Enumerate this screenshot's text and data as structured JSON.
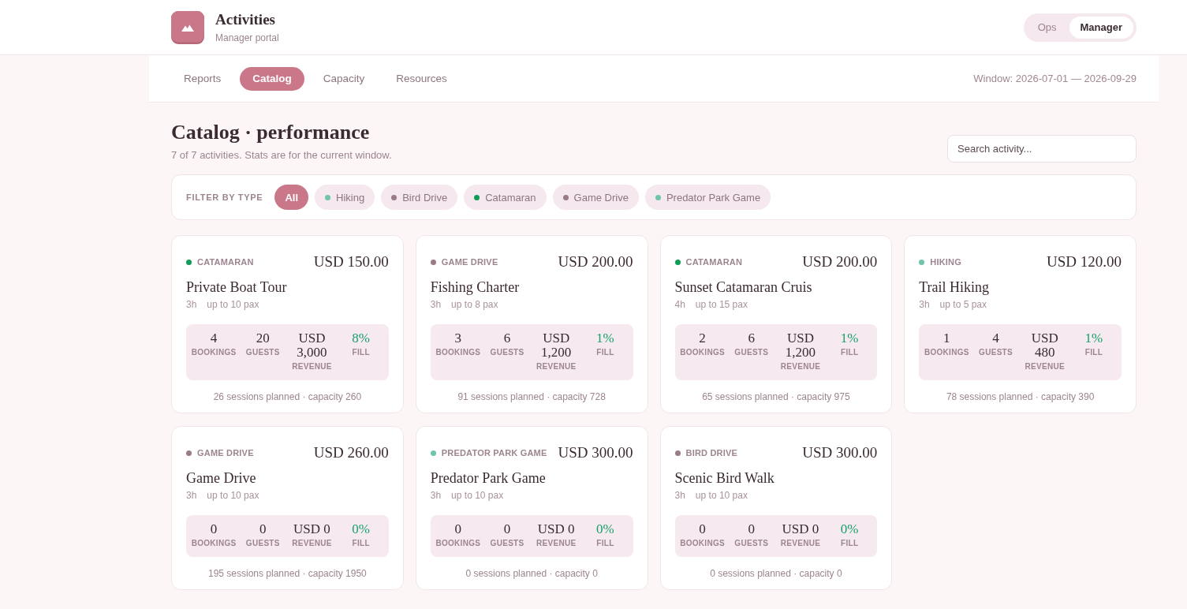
{
  "header": {
    "title": "Activities",
    "subtitle": "Manager portal",
    "role_toggle": [
      {
        "label": "Ops",
        "selected": false
      },
      {
        "label": "Manager",
        "selected": true
      }
    ]
  },
  "nav": {
    "tabs": [
      {
        "label": "Reports",
        "selected": false
      },
      {
        "label": "Catalog",
        "selected": true
      },
      {
        "label": "Capacity",
        "selected": false
      },
      {
        "label": "Resources",
        "selected": false
      }
    ],
    "window": "Window: 2026-07-01 — 2026-09-29"
  },
  "page": {
    "title": "Catalog · performance",
    "subtitle": "7 of 7 activities. Stats are for the current window.",
    "search": {
      "placeholder": "Search activity..."
    }
  },
  "filter": {
    "label": "FILTER BY TYPE",
    "chips": [
      {
        "label": "All",
        "selected": true
      },
      {
        "label": "Hiking",
        "selected": false,
        "color": "#6fc4ad"
      },
      {
        "label": "Bird Drive",
        "selected": false,
        "color": "#9a7b88"
      },
      {
        "label": "Catamaran",
        "selected": false,
        "color": "#0f9d58"
      },
      {
        "label": "Game Drive",
        "selected": false,
        "color": "#9a7b88"
      },
      {
        "label": "Predator Park Game",
        "selected": false,
        "color": "#6fc4ad"
      }
    ]
  },
  "activities": [
    {
      "type": "CATAMARAN",
      "color": "#0f9d58",
      "price": "USD 150.00",
      "name": "Private Boat Tour",
      "duration": "3h",
      "capacity": "up to 10 pax",
      "stats": [
        {
          "kind": "count",
          "value": "4",
          "label": "BOOKINGS"
        },
        {
          "kind": "count",
          "value": "20",
          "label": "GUESTS"
        },
        {
          "kind": "count",
          "value": "USD 3,000",
          "label": "REVENUE"
        },
        {
          "kind": "fill",
          "value": "8%",
          "label": "FILL"
        }
      ],
      "footer": "26 sessions planned · capacity 260"
    },
    {
      "type": "GAME DRIVE",
      "color": "#9a7b88",
      "price": "USD 200.00",
      "name": "Fishing Charter",
      "duration": "3h",
      "capacity": "up to 8 pax",
      "stats": [
        {
          "kind": "count",
          "value": "3",
          "label": "BOOKINGS"
        },
        {
          "kind": "count",
          "value": "6",
          "label": "GUESTS"
        },
        {
          "kind": "count",
          "value": "USD 1,200",
          "label": "REVENUE"
        },
        {
          "kind": "fill",
          "value": "1%",
          "label": "FILL"
        }
      ],
      "footer": "91 sessions planned · capacity 728"
    },
    {
      "type": "CATAMARAN",
      "color": "#0f9d58",
      "price": "USD 200.00",
      "name": "Sunset Catamaran Cruis",
      "duration": "4h",
      "capacity": "up to 15 pax",
      "stats": [
        {
          "kind": "count",
          "value": "2",
          "label": "BOOKINGS"
        },
        {
          "kind": "count",
          "value": "6",
          "label": "GUESTS"
        },
        {
          "kind": "count",
          "value": "USD 1,200",
          "label": "REVENUE"
        },
        {
          "kind": "fill",
          "value": "1%",
          "label": "FILL"
        }
      ],
      "footer": "65 sessions planned · capacity 975"
    },
    {
      "type": "HIKING",
      "color": "#6fc4ad",
      "price": "USD 120.00",
      "name": "Trail Hiking",
      "duration": "3h",
      "capacity": "up to 5 pax",
      "stats": [
        {
          "kind": "count",
          "value": "1",
          "label": "BOOKINGS"
        },
        {
          "kind": "count",
          "value": "4",
          "label": "GUESTS"
        },
        {
          "kind": "count",
          "value": "USD 480",
          "label": "REVENUE"
        },
        {
          "kind": "fill",
          "value": "1%",
          "label": "FILL"
        }
      ],
      "footer": "78 sessions planned · capacity 390"
    },
    {
      "type": "GAME DRIVE",
      "color": "#9a7b88",
      "price": "USD 260.00",
      "name": "Game Drive",
      "duration": "3h",
      "capacity": "up to 10 pax",
      "stats": [
        {
          "kind": "count",
          "value": "0",
          "label": "BOOKINGS"
        },
        {
          "kind": "count",
          "value": "0",
          "label": "GUESTS"
        },
        {
          "kind": "count",
          "value": "USD 0",
          "label": "REVENUE"
        },
        {
          "kind": "fill",
          "value": "0%",
          "label": "FILL"
        }
      ],
      "footer": "195 sessions planned · capacity 1950"
    },
    {
      "type": "PREDATOR PARK GAME",
      "color": "#6fc4ad",
      "price": "USD 300.00",
      "name": "Predator Park Game",
      "duration": "3h",
      "capacity": "up to 10 pax",
      "stats": [
        {
          "kind": "count",
          "value": "0",
          "label": "BOOKINGS"
        },
        {
          "kind": "count",
          "value": "0",
          "label": "GUESTS"
        },
        {
          "kind": "count",
          "value": "USD 0",
          "label": "REVENUE"
        },
        {
          "kind": "fill",
          "value": "0%",
          "label": "FILL"
        }
      ],
      "footer": "0 sessions planned · capacity 0"
    },
    {
      "type": "BIRD DRIVE",
      "color": "#9a7b88",
      "price": "USD 300.00",
      "name": "Scenic Bird Walk",
      "duration": "3h",
      "capacity": "up to 10 pax",
      "stats": [
        {
          "kind": "count",
          "value": "0",
          "label": "BOOKINGS"
        },
        {
          "kind": "count",
          "value": "0",
          "label": "GUESTS"
        },
        {
          "kind": "count",
          "value": "USD 0",
          "label": "REVENUE"
        },
        {
          "kind": "fill",
          "value": "0%",
          "label": "FILL"
        }
      ],
      "footer": "0 sessions planned · capacity 0"
    }
  ]
}
